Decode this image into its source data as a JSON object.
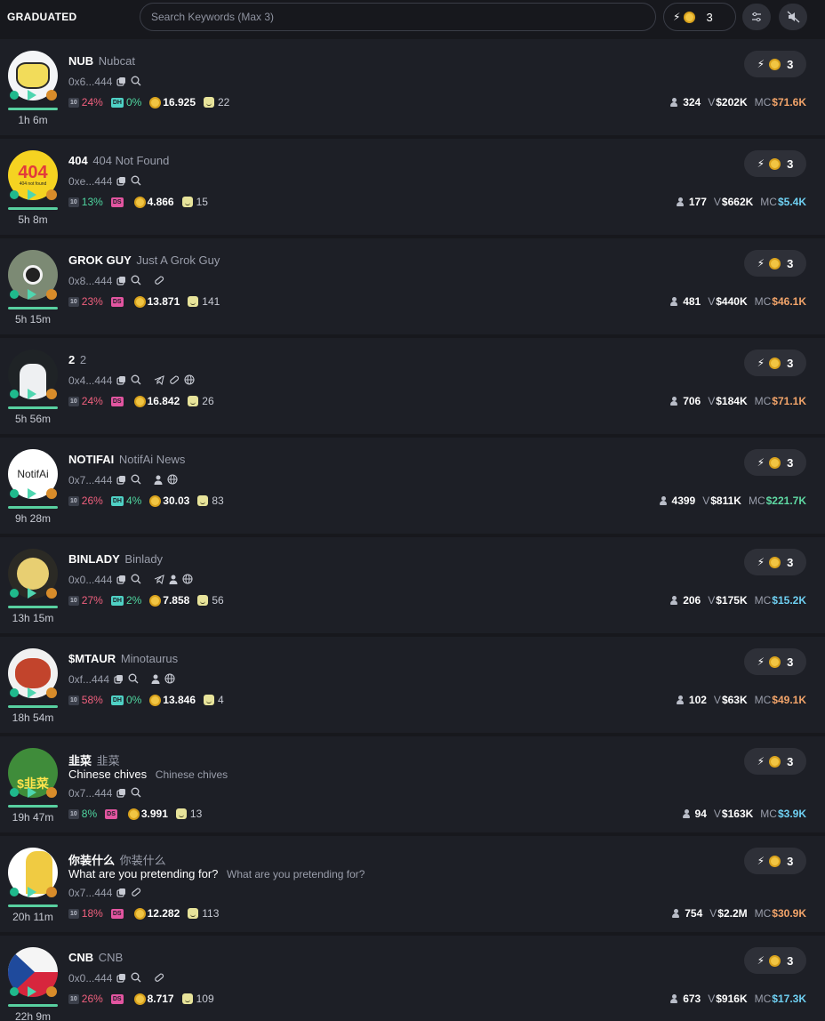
{
  "header": {
    "title": "GRADUATED",
    "search_placeholder": "Search Keywords (Max 3)",
    "quick_buy_amount": "3",
    "icons": [
      "bolt-icon",
      "coin-icon",
      "filter-icon",
      "mute-icon"
    ]
  },
  "colors": {
    "background": "#17181d",
    "row": "#1d1f26",
    "mc_orange": "#f2a46a",
    "mc_blue": "#6fd0f2",
    "mc_green": "#5fd9a3",
    "pct_red": "#f0607e",
    "pct_green": "#4fd6a0"
  },
  "tokens": [
    {
      "ticker": "NUB",
      "name": "Nubcat",
      "desc": "",
      "desc_sub": "",
      "address": "0x6...444",
      "socials": [
        "copy-icon",
        "search-icon"
      ],
      "age": "1h 6m",
      "top10": "24%",
      "top10_color": "red",
      "dev_tag": "DH",
      "dev_pct": "0%",
      "coin_value": "16.925",
      "holders_count": "22",
      "buy_amount": "3",
      "holders": "324",
      "volume": "$202K",
      "mc": "$71.6K",
      "mc_color": "orange",
      "avatar": "cat-avatar"
    },
    {
      "ticker": "404",
      "name": "404 Not Found",
      "desc": "",
      "desc_sub": "",
      "address": "0xe...444",
      "socials": [
        "copy-icon",
        "search-icon"
      ],
      "age": "5h 8m",
      "top10": "13%",
      "top10_color": "green",
      "dev_tag": "DS",
      "dev_pct": "",
      "coin_value": "4.866",
      "holders_count": "15",
      "buy_amount": "3",
      "holders": "177",
      "volume": "$662K",
      "mc": "$5.4K",
      "mc_color": "blue",
      "avatar": "404-avatar"
    },
    {
      "ticker": "GROK GUY",
      "name": "Just A Grok Guy",
      "desc": "",
      "desc_sub": "",
      "address": "0x8...444",
      "socials": [
        "copy-icon",
        "search-icon",
        "pump-icon"
      ],
      "age": "5h 15m",
      "top10": "23%",
      "top10_color": "red",
      "dev_tag": "DS",
      "dev_pct": "",
      "coin_value": "13.871",
      "holders_count": "141",
      "buy_amount": "3",
      "holders": "481",
      "volume": "$440K",
      "mc": "$46.1K",
      "mc_color": "orange",
      "avatar": "grok-avatar"
    },
    {
      "ticker": "2",
      "name": "2",
      "desc": "",
      "desc_sub": "",
      "address": "0x4...444",
      "socials": [
        "copy-icon",
        "search-icon",
        "telegram-icon",
        "pump-icon",
        "globe-icon"
      ],
      "age": "5h 56m",
      "top10": "24%",
      "top10_color": "red",
      "dev_tag": "DS",
      "dev_pct": "",
      "coin_value": "16.842",
      "holders_count": "26",
      "buy_amount": "3",
      "holders": "706",
      "volume": "$184K",
      "mc": "$71.1K",
      "mc_color": "orange",
      "avatar": "man-avatar"
    },
    {
      "ticker": "NOTIFAI",
      "name": "NotifAi News",
      "desc": "",
      "desc_sub": "",
      "address": "0x7...444",
      "socials": [
        "copy-icon",
        "search-icon",
        "user-icon",
        "globe-icon"
      ],
      "age": "9h 28m",
      "top10": "26%",
      "top10_color": "red",
      "dev_tag": "DH",
      "dev_pct": "4%",
      "coin_value": "30.03",
      "holders_count": "83",
      "buy_amount": "3",
      "holders": "4399",
      "volume": "$811K",
      "mc": "$221.7K",
      "mc_color": "green",
      "avatar": "notifai-avatar",
      "avatar_text": "NotifAi"
    },
    {
      "ticker": "BINLADY",
      "name": "Binlady",
      "desc": "",
      "desc_sub": "",
      "address": "0x0...444",
      "socials": [
        "copy-icon",
        "search-icon",
        "telegram-icon",
        "user-icon",
        "globe-icon"
      ],
      "age": "13h 15m",
      "top10": "27%",
      "top10_color": "red",
      "dev_tag": "DH",
      "dev_pct": "2%",
      "coin_value": "7.858",
      "holders_count": "56",
      "buy_amount": "3",
      "holders": "206",
      "volume": "$175K",
      "mc": "$15.2K",
      "mc_color": "blue",
      "avatar": "binlady-avatar"
    },
    {
      "ticker": "$MTAUR",
      "name": "Minotaurus",
      "desc": "",
      "desc_sub": "",
      "address": "0xf...444",
      "socials": [
        "copy-icon",
        "search-icon",
        "user-icon",
        "globe-icon"
      ],
      "age": "18h 54m",
      "top10": "58%",
      "top10_color": "red",
      "dev_tag": "DH",
      "dev_pct": "0%",
      "coin_value": "13.846",
      "holders_count": "4",
      "buy_amount": "3",
      "holders": "102",
      "volume": "$63K",
      "mc": "$49.1K",
      "mc_color": "orange",
      "avatar": "minotaur-avatar"
    },
    {
      "ticker": "韭菜",
      "name": "韭菜",
      "desc": "Chinese chives",
      "desc_sub": "Chinese chives",
      "address": "0x7...444",
      "socials": [
        "copy-icon",
        "search-icon"
      ],
      "age": "19h 47m",
      "top10": "8%",
      "top10_color": "green",
      "dev_tag": "DS",
      "dev_pct": "",
      "coin_value": "3.991",
      "holders_count": "13",
      "buy_amount": "3",
      "holders": "94",
      "volume": "$163K",
      "mc": "$3.9K",
      "mc_color": "blue",
      "avatar": "chives-avatar"
    },
    {
      "ticker": "你装什么",
      "name": "你装什么",
      "desc": "What are you pretending for?",
      "desc_sub": "What are you pretending for?",
      "address": "0x7...444",
      "socials": [
        "copy-icon",
        "pump-icon"
      ],
      "age": "20h 11m",
      "top10": "18%",
      "top10_color": "red",
      "dev_tag": "DS",
      "dev_pct": "",
      "coin_value": "12.282",
      "holders_count": "113",
      "buy_amount": "3",
      "holders": "754",
      "volume": "$2.2M",
      "mc": "$30.9K",
      "mc_color": "orange",
      "avatar": "pretend-avatar"
    },
    {
      "ticker": "CNB",
      "name": "CNB",
      "desc": "",
      "desc_sub": "",
      "address": "0x0...444",
      "socials": [
        "copy-icon",
        "search-icon",
        "pump-icon"
      ],
      "age": "22h 9m",
      "top10": "26%",
      "top10_color": "red",
      "dev_tag": "DS",
      "dev_pct": "",
      "coin_value": "8.717",
      "holders_count": "109",
      "buy_amount": "3",
      "holders": "673",
      "volume": "$916K",
      "mc": "$17.3K",
      "mc_color": "blue",
      "avatar": "czech-flag-avatar"
    }
  ],
  "labels": {
    "volume_prefix": "V",
    "mc_prefix": "MC",
    "top10_tag": "10"
  }
}
